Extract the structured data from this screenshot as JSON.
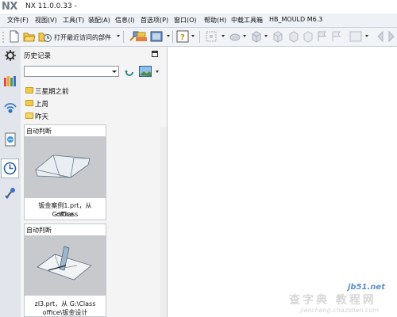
{
  "window": {
    "logo": "NX",
    "title": "NX 11.0.0.33 -"
  },
  "menu": {
    "items": [
      "文件(F)",
      "视图(V)",
      "工具(T)",
      "装配(A)",
      "信息(I)",
      "首选项(P)",
      "窗口(O)",
      "帮助(H)",
      "中载工具箱",
      "HB_MOULD M6.3"
    ]
  },
  "toolbar": {
    "recent_parts_label": "打开最近访问的部件"
  },
  "panel": {
    "title": "历史记录",
    "filter_value": "",
    "folders": [
      {
        "label": "三星期之前",
        "state": "closed"
      },
      {
        "label": "上周",
        "state": "closed"
      },
      {
        "label": "昨天",
        "state": "open"
      }
    ],
    "cards": [
      {
        "header": "自动判断",
        "caption_line1": "钣金案例1.prt，从 G:\\Class",
        "caption_line2": "office"
      },
      {
        "header": "自动判断",
        "caption_line1": "zl3.prt，从 G:\\Class",
        "caption_line2": "office\\钣金设计"
      }
    ]
  },
  "watermark": {
    "url1": "jb51.net",
    "main": "查字典 教程网",
    "url2": "jiaocheng.chazidian.com"
  },
  "colors": {
    "menubar": "#eef1f6",
    "toolbar": "#f1f3f7",
    "thumbnail": "#c8c9cc",
    "folder": "#f2c94c"
  }
}
